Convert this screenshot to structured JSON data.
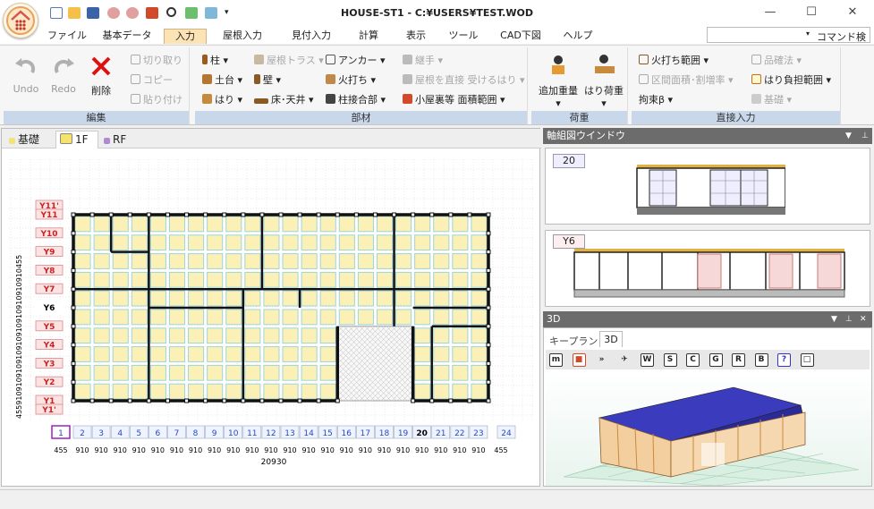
{
  "window": {
    "title": "HOUSE-ST1 - C:¥USERS¥TEST.WOD",
    "minimize": "—",
    "maximize": "☐",
    "close": "✕"
  },
  "menu": {
    "tabs": [
      "ファイル",
      "基本データ",
      "入力",
      "屋根入力",
      "見付入力",
      "計算",
      "表示",
      "ツール",
      "CAD下図",
      "ヘルプ"
    ],
    "active": "入力",
    "command_search": "コマンド検索"
  },
  "ribbon": {
    "edit": {
      "caption": "編集",
      "undo": "Undo",
      "redo": "Redo",
      "delete": "削除",
      "cut": "切り取り",
      "copy": "コピー",
      "paste": "貼り付け"
    },
    "members": {
      "caption": "部材",
      "col": "柱 ▾",
      "sill": "土台 ▾",
      "beam": "はり ▾",
      "roof_truss": "屋根トラス ▾",
      "wall": "壁 ▾",
      "floor_ceiling": "床･天井 ▾",
      "anchor": "アンカー ▾",
      "hiuchi": "火打ち ▾",
      "column_joint": "柱接合部 ▾",
      "tsugite": "継手 ▾",
      "roof_direct": "屋根を直接 受けるはり ▾",
      "attic": "小屋裏等 面積範囲 ▾"
    },
    "load": {
      "caption": "荷重",
      "add_load": "追加重量 ▾",
      "beam_load": "はり荷重 ▾"
    },
    "direct": {
      "caption": "直接入力",
      "hiuchi_range": "火打ち範囲 ▾",
      "area_ratio": "区間面積･割増率 ▾",
      "restraint": "拘束β ▾",
      "quality": "品確法 ▾",
      "beam_range": "はり負担範囲 ▾",
      "foundation": "基礎 ▾"
    }
  },
  "floors": {
    "tabs": [
      "基礎",
      "1F",
      "RF"
    ],
    "active": "1F"
  },
  "plan": {
    "y_labels": [
      "Y11'",
      "Y11",
      "Y10",
      "Y9",
      "Y8",
      "Y7",
      "Y6",
      "Y5",
      "Y4",
      "Y3",
      "Y2",
      "Y1",
      "Y1'"
    ],
    "x_labels": [
      "1",
      "2",
      "3",
      "4",
      "5",
      "6",
      "7",
      "8",
      "9",
      "10",
      "11",
      "12",
      "13",
      "14",
      "15",
      "16",
      "17",
      "18",
      "19",
      "20",
      "21",
      "22",
      "23",
      "24"
    ],
    "x_dims": [
      "455",
      "910",
      "910",
      "910",
      "910",
      "910",
      "910",
      "910",
      "910",
      "910",
      "910",
      "910",
      "910",
      "910",
      "910",
      "910",
      "910",
      "910",
      "910",
      "910",
      "910",
      "910",
      "910",
      "455"
    ],
    "x_total": "20930",
    "y_dims": [
      "455",
      "910",
      "910",
      "910",
      "910",
      "910",
      "910",
      "910",
      "910",
      "910",
      "910",
      "455"
    ]
  },
  "axis_window": {
    "title": "軸組図ウインドウ",
    "views": [
      "20",
      "Y6"
    ]
  },
  "view3d": {
    "title": "3D",
    "tabs": [
      "キープラン",
      "3D"
    ],
    "active": "3D",
    "tools": [
      "m",
      "■",
      "»",
      "✈",
      "W",
      "S",
      "C",
      "G",
      "R",
      "B",
      "?",
      "□"
    ]
  }
}
